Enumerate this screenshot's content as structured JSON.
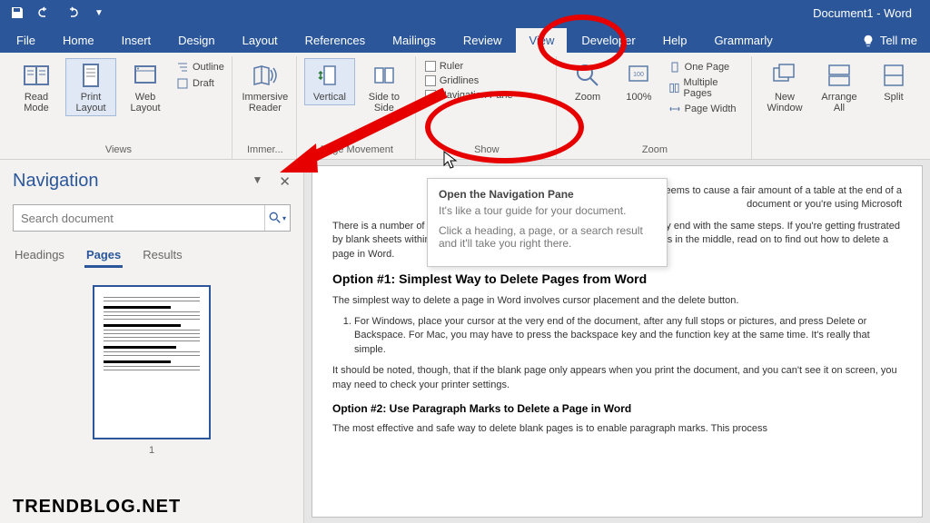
{
  "title": "Document1 - Word",
  "tabs": [
    "File",
    "Home",
    "Insert",
    "Design",
    "Layout",
    "References",
    "Mailings",
    "Review",
    "View",
    "Developer",
    "Help",
    "Grammarly"
  ],
  "active_tab": "View",
  "tell_me": "Tell me",
  "ribbon": {
    "views": {
      "label": "Views",
      "read_mode": "Read Mode",
      "print_layout": "Print Layout",
      "web_layout": "Web Layout",
      "outline": "Outline",
      "draft": "Draft"
    },
    "immersive": {
      "label": "Immer...",
      "reader": "Immersive Reader"
    },
    "page_movement": {
      "label": "Page Movement",
      "vertical": "Vertical",
      "side": "Side to Side"
    },
    "show": {
      "label": "Show",
      "ruler": "Ruler",
      "gridlines": "Gridlines",
      "nav_pane": "Navigation Pane",
      "nav_checked": true
    },
    "zoom": {
      "label": "Zoom",
      "zoom": "Zoom",
      "hundred": "100%",
      "one_page": "One Page",
      "multiple": "Multiple Pages",
      "page_width": "Page Width"
    },
    "window": {
      "new_window": "New Window",
      "arrange_all": "Arrange All",
      "split": "Split"
    }
  },
  "tooltip": {
    "title": "Open the Navigation Pane",
    "line1": "It's like a tour guide for your document.",
    "line2": "Click a heading, a page, or a search result and it'll take you right there."
  },
  "nav": {
    "title": "Navigation",
    "search_placeholder": "Search document",
    "tabs": {
      "headings": "Headings",
      "pages": "Pages",
      "results": "Results"
    },
    "thumb_num": "1"
  },
  "doc": {
    "p1": "ete a page in Word, but it seems to cause a fair amount of a table at the end of a document or you're using Microsoft",
    "p2": "There is a number of methods used to solve the issue, but they all effectively end with the same steps. If you're getting frustrated by blank sheets within your perfectly honed documents, or have rogue pages in the middle, read on to find out how to delete a page in Word.",
    "h1": "Option #1: Simplest Way to Delete Pages from Word",
    "p3": "The simplest way to delete a page in Word involves cursor placement and the delete button.",
    "li1": "For Windows, place your cursor at the very end of the document, after any full stops or pictures, and press Delete or Backspace. For Mac, you may have to press the backspace key and the function key at the same time. It's really that simple.",
    "p4": "It should be noted, though, that if the blank page only appears when you print the document, and you can't see it on screen, you may need to check your printer settings.",
    "h2": "Option #2: Use Paragraph Marks to Delete a Page in Word",
    "p5": "The most effective and safe way to delete blank pages is to enable paragraph marks. This process"
  },
  "watermark": "TRENDBLOG.NET"
}
